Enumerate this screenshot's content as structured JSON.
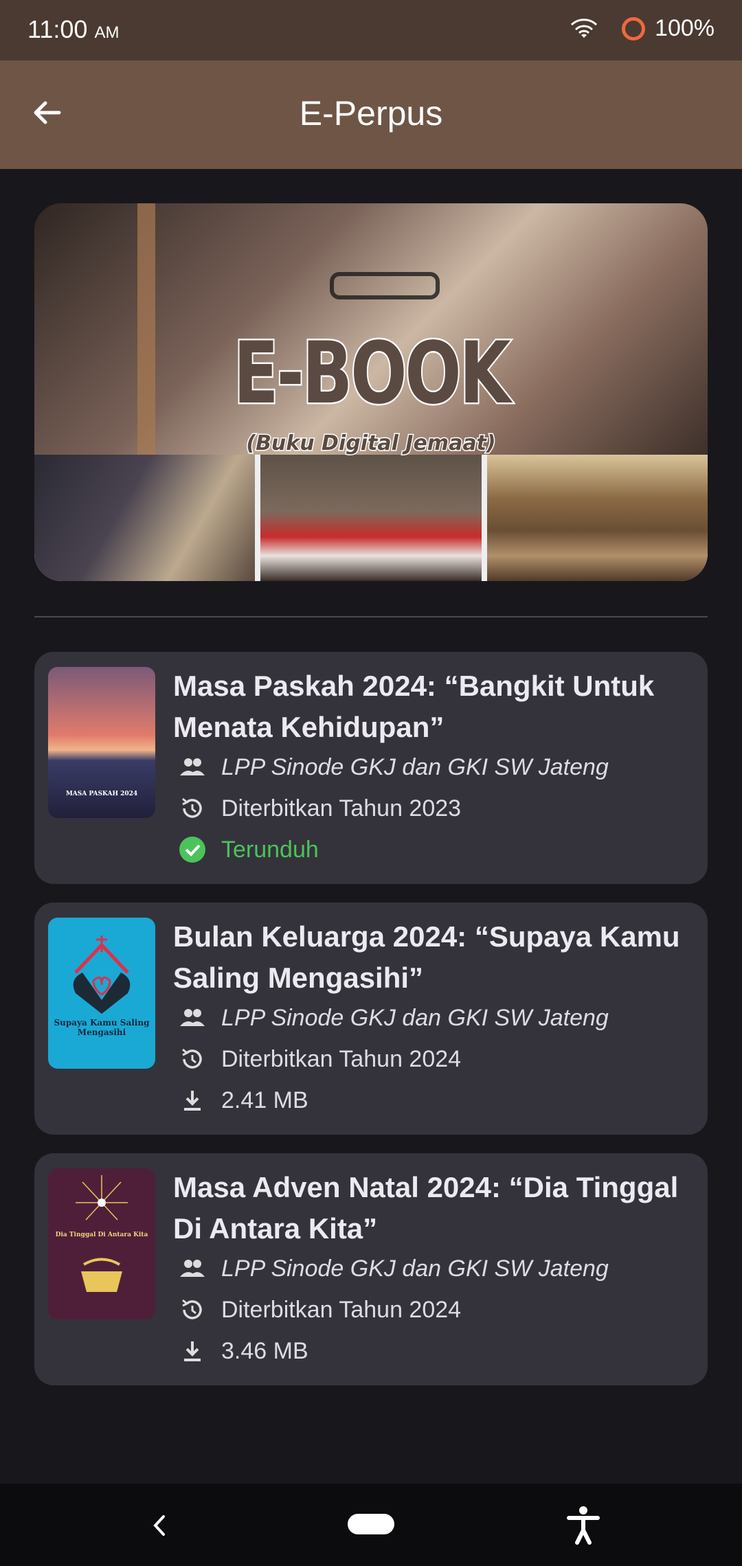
{
  "status_bar": {
    "time": "11:00",
    "ampm": "AM",
    "battery": "100%",
    "battery_color": "#f0683f"
  },
  "app_bar": {
    "title": "E-Perpus",
    "color": "#6e5546"
  },
  "banner": {
    "heading": "E-BOOK",
    "subheading": "(Buku Digital Jemaat)"
  },
  "books": [
    {
      "title": "Masa Paskah 2024: “Bangkit Untuk Menata Kehidupan”",
      "author": "LPP Sinode GKJ dan GKI SW Jateng",
      "published": "Diterbitkan Tahun 2023",
      "status": "Terunduh",
      "status_icon": "check-circle-icon",
      "cover_text": "MASA PASKAH 2024"
    },
    {
      "title": "Bulan Keluarga 2024: “Supaya Kamu Saling Mengasihi”",
      "author": "LPP Sinode GKJ dan GKI SW Jateng",
      "published": "Diterbitkan Tahun 2024",
      "size": "2.41 MB",
      "cover_text": "Supaya Kamu Saling Mengasihi"
    },
    {
      "title": "Masa Adven Natal 2024: “Dia Tinggal Di Antara Kita”",
      "author": "LPP Sinode GKJ dan GKI SW Jateng",
      "published": "Diterbitkan Tahun 2024",
      "size": "3.46 MB",
      "cover_text": "Dia Tinggal Di Antara Kita"
    }
  ],
  "colors": {
    "background": "#18171c",
    "card": "#34333b",
    "success": "#4cc35a",
    "status_bar": "#4a3a31"
  },
  "nav_bar": {
    "icons": [
      "back-icon",
      "home-pill-icon",
      "accessibility-icon"
    ]
  }
}
